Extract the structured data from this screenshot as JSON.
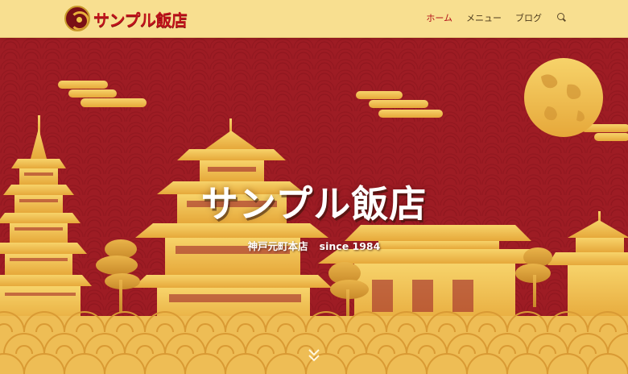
{
  "site": {
    "name": "サンプル飯店"
  },
  "nav": {
    "items": [
      {
        "label": "ホーム",
        "active": true
      },
      {
        "label": "メニュー",
        "active": false
      },
      {
        "label": "ブログ",
        "active": false
      }
    ]
  },
  "hero": {
    "title": "サンプル飯店",
    "subtitle_location": "神戸元町本店",
    "subtitle_since": "since 1984"
  },
  "colors": {
    "header_bg": "#f8df90",
    "hero_bg": "#9e1c24",
    "gold": "#f2c14a",
    "accent_red": "#c0141b"
  },
  "icons": {
    "logo": "dragon-logo-icon",
    "search": "search-icon",
    "scroll": "chevron-double-down-icon"
  }
}
